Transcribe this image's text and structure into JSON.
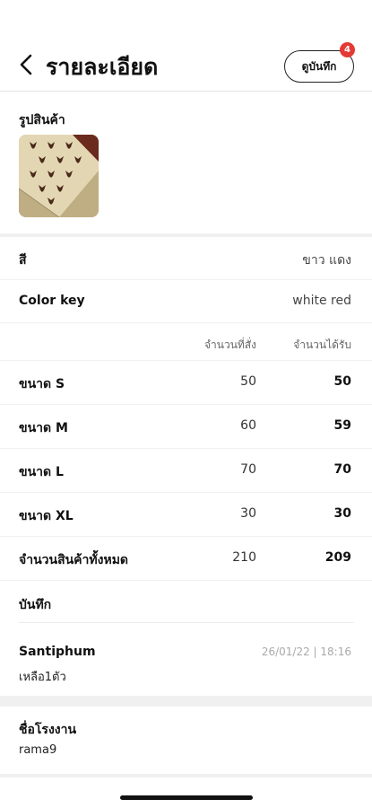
{
  "header": {
    "title": "รายละเอียด",
    "notes_button": "ดูบันทึก",
    "notes_badge": "4"
  },
  "product_photo": {
    "label": "รูปสินค้า",
    "icon": "product-thumbnail"
  },
  "details": {
    "color_label": "สี",
    "color_value": "ขาว แดง",
    "color_key_label": "Color key",
    "color_key_value": "white red"
  },
  "quantities": {
    "ordered_header": "จำนวนที่สั่ง",
    "received_header": "จำนวนได้รับ",
    "sizes": [
      {
        "label": "ขนาด S",
        "ordered": "50",
        "received": "50"
      },
      {
        "label": "ขนาด M",
        "ordered": "60",
        "received": "59"
      },
      {
        "label": "ขนาด L",
        "ordered": "70",
        "received": "70"
      },
      {
        "label": "ขนาด XL",
        "ordered": "30",
        "received": "30"
      }
    ],
    "total_label": "จำนวนสินค้าทั้งหมด",
    "total_ordered": "210",
    "total_received": "209"
  },
  "notes": {
    "label": "บันทึก",
    "entries": [
      {
        "author": "Santiphum",
        "date": "26/01/22 | 18:16",
        "text": "เหลือ1ตัว"
      }
    ]
  },
  "factory": {
    "label": "ชื่อโรงงาน",
    "value": "rama9"
  },
  "colors": {
    "badge": "#e53935",
    "divider": "#f0f0f0"
  }
}
